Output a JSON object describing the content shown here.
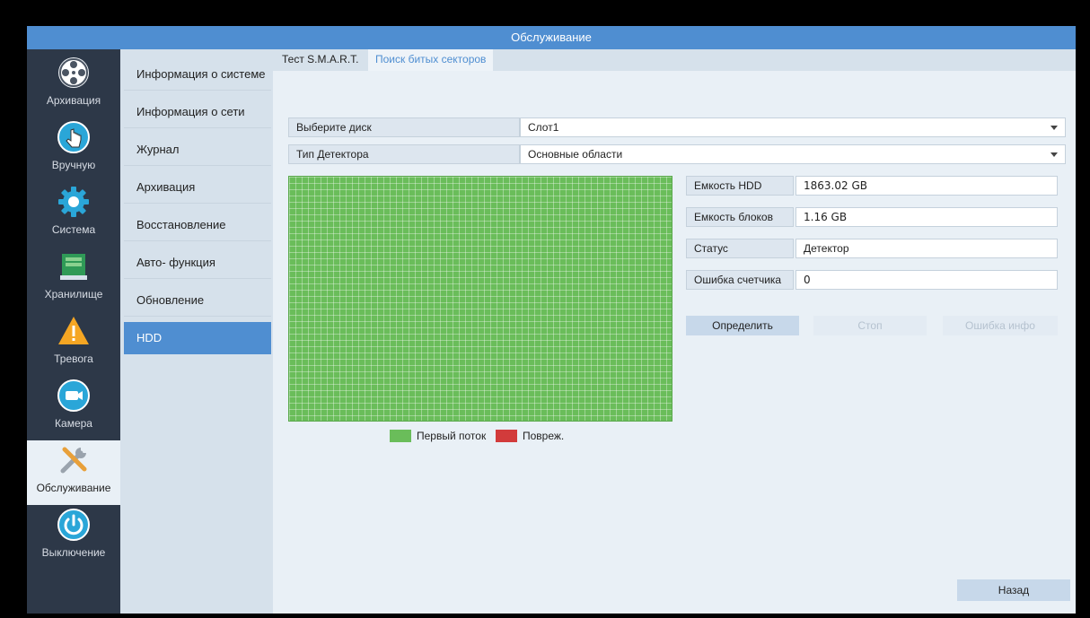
{
  "window": {
    "title": "Обслуживание"
  },
  "nav": [
    {
      "label": "Архивация",
      "icon": "film-reel-icon"
    },
    {
      "label": "Вручную",
      "icon": "hand-pointer-icon"
    },
    {
      "label": "Система",
      "icon": "gear-icon"
    },
    {
      "label": "Хранилище",
      "icon": "storage-icon"
    },
    {
      "label": "Тревога",
      "icon": "warning-icon"
    },
    {
      "label": "Камера",
      "icon": "camera-icon"
    },
    {
      "label": "Обслуживание",
      "icon": "tools-icon",
      "active": true
    },
    {
      "label": "Выключение",
      "icon": "power-icon"
    }
  ],
  "submenu": [
    "Информация о системе",
    "Информация о сети",
    "Журнал",
    "Архивация",
    "Восстановление",
    "Авто- функция",
    "Обновление",
    "HDD"
  ],
  "tabs": [
    "Тест S.M.A.R.T.",
    "Поиск битых секторов"
  ],
  "form": {
    "disk_label": "Выберите диск",
    "disk_value": "Слот1",
    "detector_label": "Тип Детектора",
    "detector_value": "Основные области"
  },
  "info": {
    "hdd_capacity_label": "Емкость HDD",
    "hdd_capacity_value": "1863.02 GB",
    "block_capacity_label": "Емкость блоков",
    "block_capacity_value": "1.16 GB",
    "status_label": "Статус",
    "status_value": "Детектор",
    "error_count_label": "Ошибка счетчика",
    "error_count_value": "0"
  },
  "buttons": {
    "detect": "Определить",
    "stop": "Стоп",
    "error_info": "Ошибка инфо",
    "back": "Назад"
  },
  "legend": {
    "ok_label": "Первый поток",
    "damaged_label": "Повреж.",
    "ok_color": "#6abd5a",
    "damaged_color": "#d23b3b"
  },
  "colors": {
    "accent": "#4f8ed1",
    "sidebar": "#2d3848"
  }
}
